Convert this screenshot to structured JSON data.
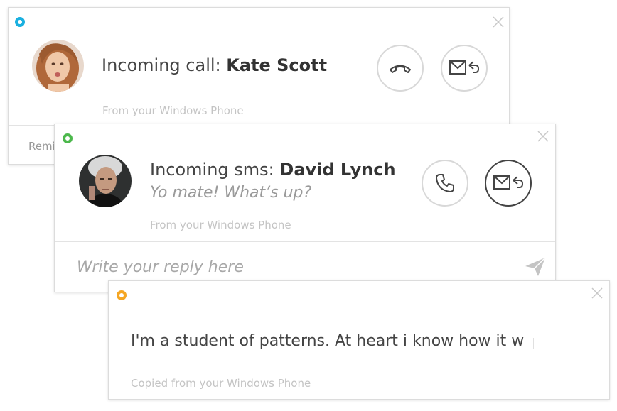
{
  "call_card": {
    "status_color": "#1ab0e0",
    "title_prefix": "Incoming call: ",
    "caller_name": "Kate Scott",
    "footer": "From your Windows Phone",
    "partial_footer": "Remi",
    "decline_icon": "hang-up-icon",
    "reply_icon": "message-reply-icon"
  },
  "sms_card": {
    "status_color": "#4cb84c",
    "title_prefix": "Incoming sms: ",
    "sender_name": "David Lynch",
    "message": "Yo mate! What’s up?",
    "footer": "From your Windows Phone",
    "reply_placeholder": "Write your reply here",
    "call_icon": "phone-icon",
    "reply_icon": "message-reply-icon",
    "send_icon": "send-icon"
  },
  "clipboard_card": {
    "status_color": "#f5a623",
    "text": "I'm a student of patterns. At heart i know how it w",
    "footer": "Copied from your Windows Phone"
  }
}
